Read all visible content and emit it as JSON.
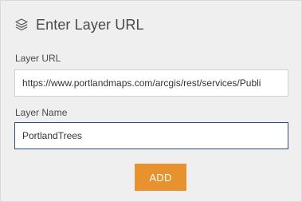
{
  "dialog": {
    "title": "Enter Layer URL",
    "icon": "layers-icon"
  },
  "layer_url": {
    "label": "Layer URL",
    "value": "https://www.portlandmaps.com/arcgis/rest/services/Publi"
  },
  "layer_name": {
    "label": "Layer Name",
    "value": "PortlandTrees"
  },
  "actions": {
    "add_label": "ADD"
  },
  "colors": {
    "accent": "#e8912f",
    "focus_border": "#2d4f7a",
    "panel_background": "#efefef"
  }
}
